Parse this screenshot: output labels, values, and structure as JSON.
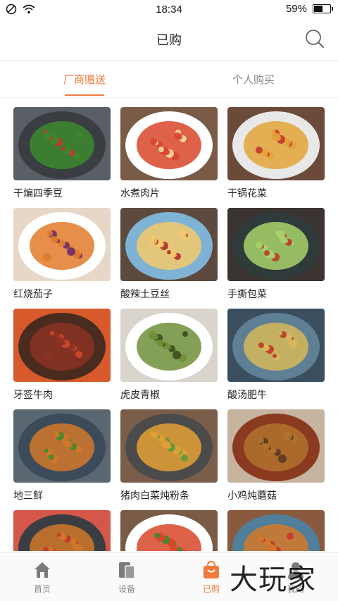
{
  "status_bar": {
    "time": "18:34",
    "battery": "59%",
    "battery_level": 0.59
  },
  "header": {
    "title": "已购",
    "search_icon": "search-icon"
  },
  "tabs": [
    {
      "label": "厂商赠送",
      "active": true
    },
    {
      "label": "个人购买",
      "active": false
    }
  ],
  "dishes": [
    {
      "name": "干煸四季豆",
      "plate": "#3a3d42",
      "food": "#3c8a2e",
      "accent": "#c0392b",
      "bg": "#5a5f66"
    },
    {
      "name": "水煮肉片",
      "plate": "#ffffff",
      "food": "#d8452a",
      "accent": "#f1d9a8",
      "bg": "#7a5b46"
    },
    {
      "name": "干锅花菜",
      "plate": "#e8e8e8",
      "food": "#e2a437",
      "accent": "#c0392b",
      "bg": "#6b4a3a"
    },
    {
      "name": "红烧茄子",
      "plate": "#ffffff",
      "food": "#e07b2a",
      "accent": "#6a2c6a",
      "bg": "#e6d7c7"
    },
    {
      "name": "酸辣土豆丝",
      "plate": "#7fb3d5",
      "food": "#f3c96b",
      "accent": "#b0302c",
      "bg": "#5d4a3e"
    },
    {
      "name": "手撕包菜",
      "plate": "#2f3a3a",
      "food": "#a7d46b",
      "accent": "#c0392b",
      "bg": "#3c3431"
    },
    {
      "name": "牙签牛肉",
      "plate": "#4a2b20",
      "food": "#8a3322",
      "accent": "#d4472c",
      "bg": "#d85a2a"
    },
    {
      "name": "虎皮青椒",
      "plate": "#ffffff",
      "food": "#6f8f3a",
      "accent": "#3e4a1e",
      "bg": "#d9d4cc"
    },
    {
      "name": "酸汤肥牛",
      "plate": "#5f7f95",
      "food": "#d6b85a",
      "accent": "#c0392b",
      "bg": "#3a4e5e"
    },
    {
      "name": "地三鲜",
      "plate": "#3b4b5a",
      "food": "#d2782a",
      "accent": "#3f8a2e",
      "bg": "#5a6670"
    },
    {
      "name": "猪肉白菜炖粉条",
      "plate": "#4b4b4b",
      "food": "#e3a035",
      "accent": "#5e9a3a",
      "bg": "#7b5e4a"
    },
    {
      "name": "小鸡炖蘑菇",
      "plate": "#8a3a1e",
      "food": "#b0722e",
      "accent": "#5a3a1e",
      "bg": "#c6b3a0"
    },
    {
      "name": "",
      "plate": "#3a3d42",
      "food": "#d2782a",
      "accent": "#c0392b",
      "bg": "#d4574a"
    },
    {
      "name": "",
      "plate": "#ffffff",
      "food": "#d8452a",
      "accent": "#3f8a2e",
      "bg": "#7a5b46"
    },
    {
      "name": "",
      "plate": "#4f7f9a",
      "food": "#d2782a",
      "accent": "#c0392b",
      "bg": "#8a5a3e"
    }
  ],
  "bottom_nav": [
    {
      "label": "首页",
      "icon": "home-icon",
      "active": false
    },
    {
      "label": "设备",
      "icon": "devices-icon",
      "active": false
    },
    {
      "label": "已购",
      "icon": "shopping-bag-icon",
      "active": true
    },
    {
      "label": "我的",
      "icon": "user-icon",
      "active": false
    }
  ],
  "watermark": "大玩家",
  "colors": {
    "accent": "#f07a3c",
    "text": "#222222",
    "muted": "#888888"
  }
}
